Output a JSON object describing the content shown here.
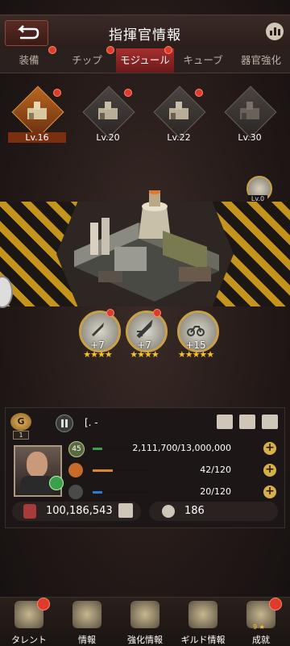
{
  "header": {
    "title": "指揮官情報",
    "back_icon": "back-arrow-icon",
    "stats_icon": "chart-icon"
  },
  "tabs": [
    {
      "label": "装備",
      "dot": true,
      "active": false
    },
    {
      "label": "チップ",
      "dot": true,
      "active": false
    },
    {
      "label": "モジュール",
      "dot": true,
      "active": true
    },
    {
      "label": "キューブ",
      "dot": false,
      "active": false
    },
    {
      "label": "器官強化",
      "dot": false,
      "active": false
    }
  ],
  "modules": [
    {
      "level": "Lv.16",
      "selected": true,
      "dot": true
    },
    {
      "level": "Lv.20",
      "selected": false,
      "dot": true
    },
    {
      "level": "Lv.22",
      "selected": false,
      "dot": true
    },
    {
      "level": "Lv.30",
      "selected": false,
      "dot": false
    }
  ],
  "side_badge": {
    "label": "Lv.0"
  },
  "skills": [
    {
      "icon": "missile-icon",
      "plus": "+7",
      "stars": "★★★★",
      "dot": true
    },
    {
      "icon": "rocket-icon",
      "plus": "+7",
      "stars": "★★★★",
      "dot": true
    },
    {
      "icon": "motorcycle-icon",
      "plus": "+15",
      "stars": "★★★★★",
      "dot": false
    }
  ],
  "panel": {
    "rank_letter": "G",
    "rank_num": "1",
    "player_name": "[.                        -",
    "bars": [
      {
        "icon": "level-icon",
        "icon_text": "45",
        "value": "2,111,700/13,000,000",
        "fill": 0.16,
        "color": "#3aa04a"
      },
      {
        "icon": "fuel-icon",
        "icon_text": "",
        "value": "42/120",
        "fill": 0.35,
        "color": "#d8892a"
      },
      {
        "icon": "energy-icon",
        "icon_text": "",
        "value": "20/120",
        "fill": 0.17,
        "color": "#2a7ad8"
      }
    ],
    "power": "100,186,543",
    "kills": "186"
  },
  "nav": [
    {
      "label": "タレント",
      "dot": true,
      "badge": ""
    },
    {
      "label": "情報",
      "dot": false,
      "badge": ""
    },
    {
      "label": "強化情報",
      "dot": false,
      "badge": ""
    },
    {
      "label": "ギルド情報",
      "dot": false,
      "badge": ""
    },
    {
      "label": "成就",
      "dot": true,
      "badge": "9 ★"
    }
  ]
}
